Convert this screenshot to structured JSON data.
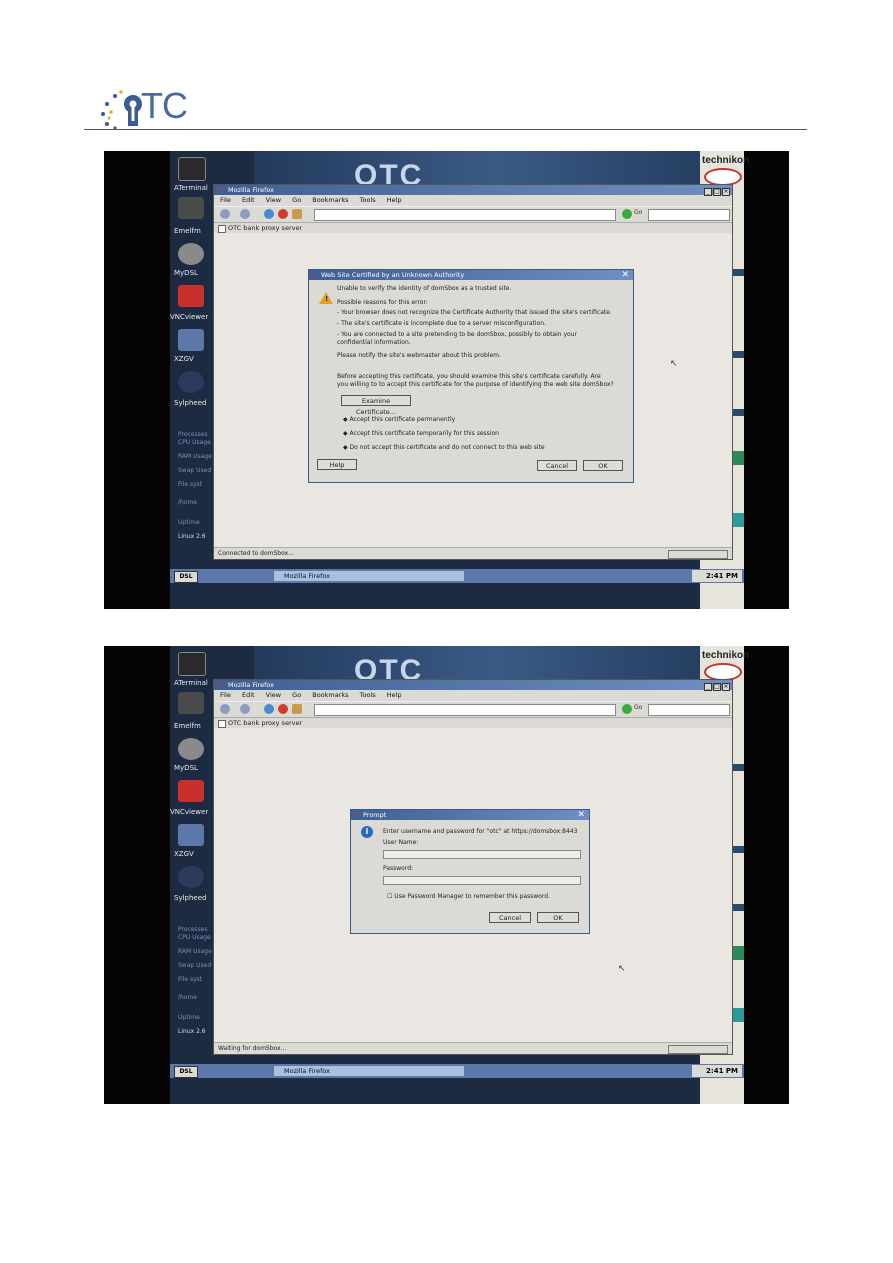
{
  "header": {
    "logo_text": "TC"
  },
  "screens": [
    {
      "desktop_icons": [
        "ATerminal",
        "Emelfm",
        "MyDSL",
        "VNCviewer",
        "XZGV",
        "Sylpheed"
      ],
      "sys_monitor": [
        "Processes",
        "CPU Usage",
        "RAM Usage",
        "Swap Used",
        "File syst",
        "/home",
        "Uptime",
        "Linux 2.6"
      ],
      "right_panel_brand": "technikon",
      "browser": {
        "title": "Mozilla Firefox",
        "menu": [
          "File",
          "Edit",
          "View",
          "Go",
          "Bookmarks",
          "Tools",
          "Help"
        ],
        "go_label": "Go",
        "tab": "OTC bank proxy server",
        "status": "Connected to domSbox..."
      },
      "taskbar": {
        "dsl": "DSL",
        "app": "Mozilla Firefox",
        "clock": "2:41 PM"
      },
      "dialog": {
        "title": "Web Site Certified by an Unknown Authority",
        "lines": [
          "Unable to verify the identity of domSbox as a trusted site.",
          "Possible reasons for this error:",
          "- Your browser does not recognize the Certificate Authority that issued the site's certificate.",
          "- The site's certificate is incomplete due to a server misconfiguration.",
          "- You are connected to a site pretending to be domSbox, possibly to obtain your",
          "confidential information.",
          "Please notify the site's webmaster about this problem.",
          "Before accepting this certificate, you should examine this site's certificate carefully. Are",
          "you willing to to accept this certificate for the purpose of identifying the web site domSbox?"
        ],
        "examine_button": "Examine Certificate...",
        "options": [
          "Accept this certificate permanently",
          "Accept this certificate temporarily for this session",
          "Do not accept this certificate and do not connect to this web site"
        ],
        "help": "Help",
        "cancel": "Cancel",
        "ok": "OK"
      }
    },
    {
      "desktop_icons": [
        "ATerminal",
        "Emelfm",
        "MyDSL",
        "VNCviewer",
        "XZGV",
        "Sylpheed"
      ],
      "sys_monitor": [
        "Processes",
        "CPU Usage",
        "RAM Usage",
        "Swap Used",
        "File syst",
        "/home",
        "Uptime",
        "Linux 2.6"
      ],
      "right_panel_brand": "technikon",
      "browser": {
        "title": "Mozilla Firefox",
        "menu": [
          "File",
          "Edit",
          "View",
          "Go",
          "Bookmarks",
          "Tools",
          "Help"
        ],
        "go_label": "Go",
        "tab": "OTC bank proxy server",
        "status": "Waiting for domSbox..."
      },
      "taskbar": {
        "dsl": "DSL",
        "app": "Mozilla Firefox",
        "clock": "2:41 PM"
      },
      "prompt": {
        "title": "Prompt",
        "message": "Enter username and password for \"otc\" at https://domsbox:8443",
        "username_label": "User Name:",
        "password_label": "Password:",
        "remember": "Use Password Manager to remember this password.",
        "cancel": "Cancel",
        "ok": "OK"
      }
    }
  ]
}
